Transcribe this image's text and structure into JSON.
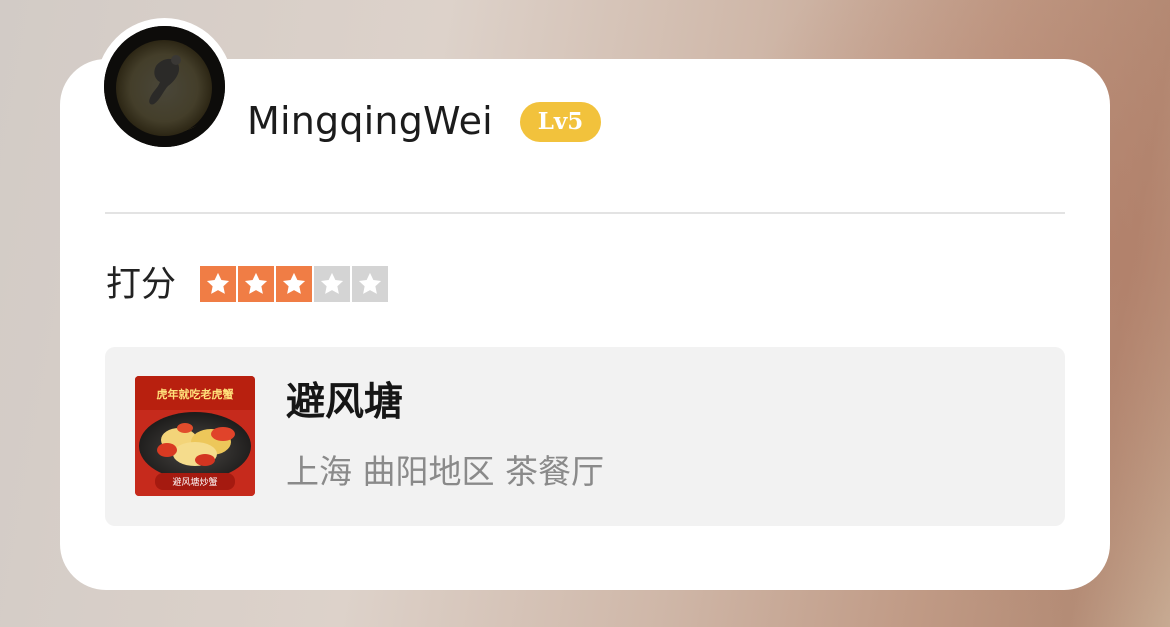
{
  "user": {
    "name": "MingqingWei",
    "level": "Lv5",
    "avatar_icon": "crescent-moon-avatar"
  },
  "rating": {
    "label": "打分",
    "score": 3,
    "max": 5,
    "active_color": "#f07d45",
    "inactive_color": "#d4d4d4"
  },
  "shop": {
    "name": "避风塘",
    "meta": "上海 曲阳地区 茶餐厅",
    "thumbnail_icon": "dish-photo",
    "thumbnail_text": "虎年就吃老虎蟹",
    "thumbnail_caption": "避风塘炒蟹"
  },
  "colors": {
    "level_badge": "#f2c23c",
    "card_background": "#ffffff",
    "shop_panel": "#f2f2f2"
  }
}
